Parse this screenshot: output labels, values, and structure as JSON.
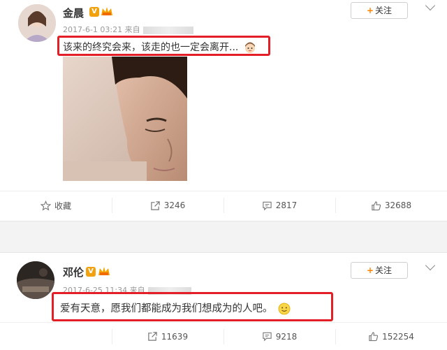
{
  "posts": [
    {
      "author": "金晨",
      "verified_badge": "V",
      "meta_time": "2017-6-1 03:21",
      "meta_from": "来自",
      "follow_label": "关注",
      "text": "该来的终究会来，该走的也一定会离开...",
      "actions": {
        "favorite_label": "收藏",
        "repost_count": "3246",
        "comment_count": "2817",
        "like_count": "32688"
      }
    },
    {
      "author": "邓伦",
      "verified_badge": "V",
      "meta_time": "2017-6-25 11:34",
      "meta_from": "来自",
      "follow_label": "关注",
      "text": "爱有天意，愿我们都能成为我们想成为的人吧。",
      "actions": {
        "repost_count": "11639",
        "comment_count": "9218",
        "like_count": "152254"
      }
    }
  ],
  "colors": {
    "highlight": "#e41e26",
    "accent": "#ff8200",
    "verified": "#f2a10f"
  },
  "icons": [
    "star-icon",
    "repost-icon",
    "comment-icon",
    "thumb-up-icon",
    "chevron-down-icon",
    "plus-icon",
    "smiley-icon"
  ]
}
